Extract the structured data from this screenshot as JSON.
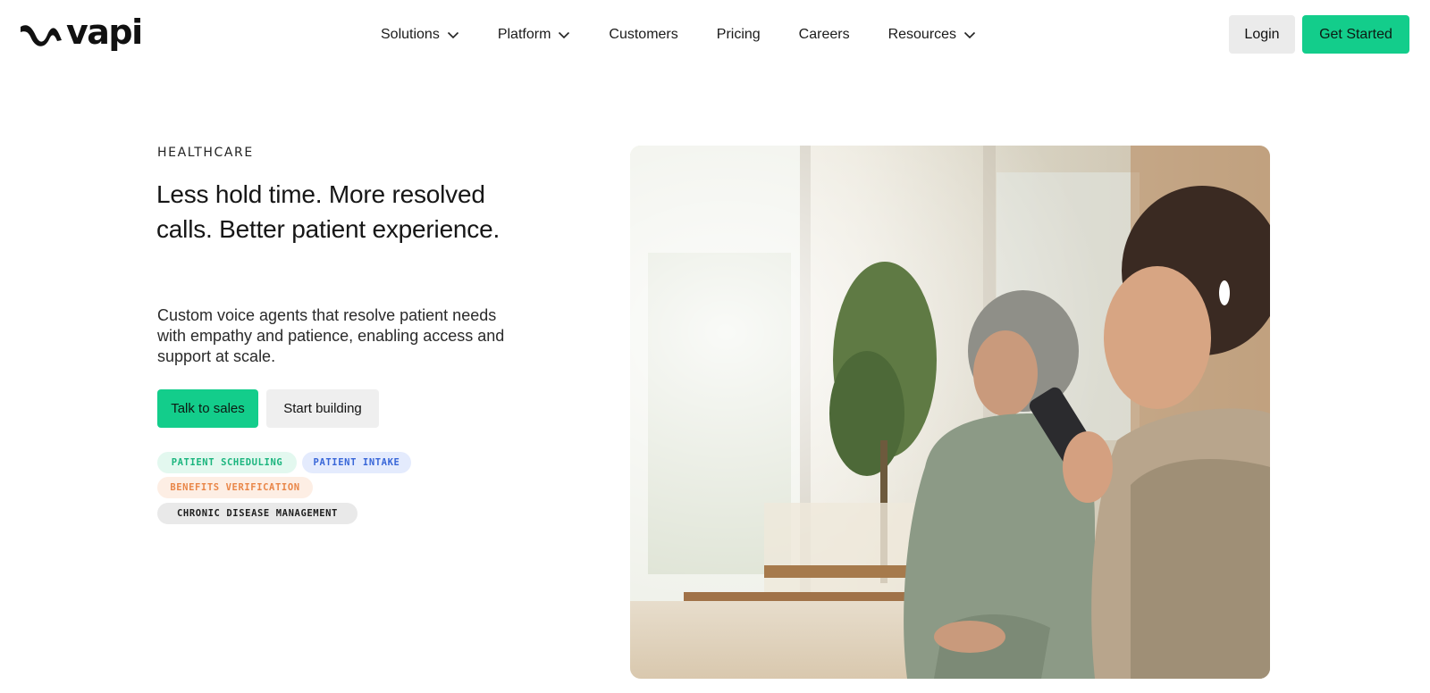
{
  "header": {
    "logo_text": "vapi",
    "logo_icon": "vapi-wave-logo",
    "nav": [
      {
        "label": "Solutions",
        "dropdown": true
      },
      {
        "label": "Platform",
        "dropdown": true
      },
      {
        "label": "Customers",
        "dropdown": false
      },
      {
        "label": "Pricing",
        "dropdown": false
      },
      {
        "label": "Careers",
        "dropdown": false
      },
      {
        "label": "Resources",
        "dropdown": true
      }
    ],
    "login_label": "Login",
    "get_started_label": "Get Started"
  },
  "hero": {
    "eyebrow": "HEALTHCARE",
    "headline": "Less hold time. More resolved calls. Better patient experience.",
    "subtext": "Custom voice agents that resolve patient needs with empathy and patience, enabling access and support at scale.",
    "primary_cta": "Talk to sales",
    "secondary_cta": "Start building",
    "tags": [
      "PATIENT SCHEDULING",
      "PATIENT INTAKE",
      "BENEFITS VERIFICATION",
      "CHRONIC DISEASE MANAGEMENT"
    ]
  },
  "colors": {
    "brand_green": "#13cd8b",
    "tag_green": "#1bb57e",
    "tag_blue": "#3866d8",
    "tag_orange": "#e98648"
  }
}
